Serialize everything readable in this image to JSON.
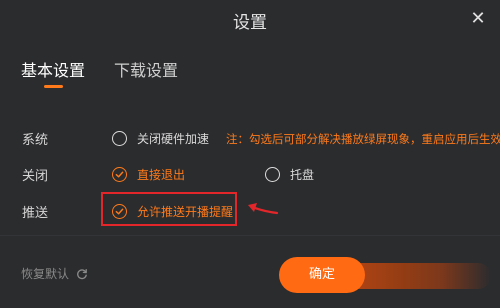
{
  "dialog": {
    "title": "设置",
    "close_icon": "close-icon"
  },
  "tabs": [
    {
      "label": "基本设置",
      "active": true
    },
    {
      "label": "下载设置",
      "active": false
    }
  ],
  "rows": {
    "system": {
      "label": "系统",
      "option_label": "关闭硬件加速",
      "checked": false,
      "note": "注：勾选后可部分解决播放绿屏现象，重启应用后生效"
    },
    "close": {
      "label": "关闭",
      "options": [
        {
          "label": "直接退出",
          "checked": true
        },
        {
          "label": "托盘",
          "checked": false
        }
      ]
    },
    "push": {
      "label": "推送",
      "option_label": "允许推送开播提醒",
      "checked": true
    }
  },
  "footer": {
    "restore_label": "恢复默认",
    "confirm_label": "确定"
  },
  "colors": {
    "accent": "#ff7a1a",
    "background": "#2b2c2e",
    "annotation_red": "#e2262a"
  }
}
